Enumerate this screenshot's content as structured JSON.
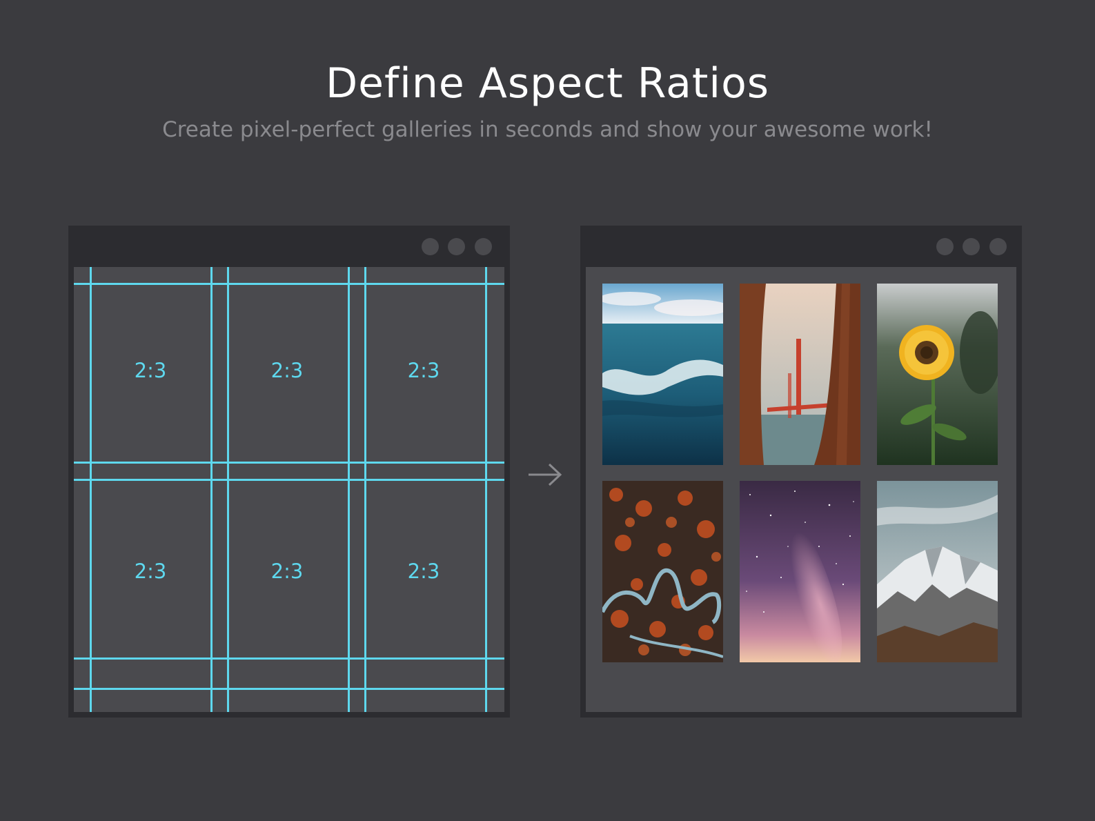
{
  "header": {
    "title": "Define Aspect Ratios",
    "subtitle": "Create pixel-perfect galleries in seconds and show your awesome work!"
  },
  "colors": {
    "background": "#3b3b3f",
    "window_frame": "#2c2c30",
    "window_content": "#4a4a4e",
    "guide_lines": "#5ed8ee",
    "subtitle_text": "#8a8a8e"
  },
  "grid_window": {
    "cells": [
      {
        "label": "2:3"
      },
      {
        "label": "2:3"
      },
      {
        "label": "2:3"
      },
      {
        "label": "2:3"
      },
      {
        "label": "2:3"
      },
      {
        "label": "2:3"
      }
    ]
  },
  "gallery_window": {
    "photos": [
      {
        "subject": "ocean-wave-photo"
      },
      {
        "subject": "golden-gate-bridge-photo"
      },
      {
        "subject": "sunflower-photo"
      },
      {
        "subject": "winding-road-forest-photo"
      },
      {
        "subject": "milky-way-sky-photo"
      },
      {
        "subject": "snowy-mountain-photo"
      }
    ]
  },
  "arrow": {
    "icon": "arrow-right-icon"
  }
}
